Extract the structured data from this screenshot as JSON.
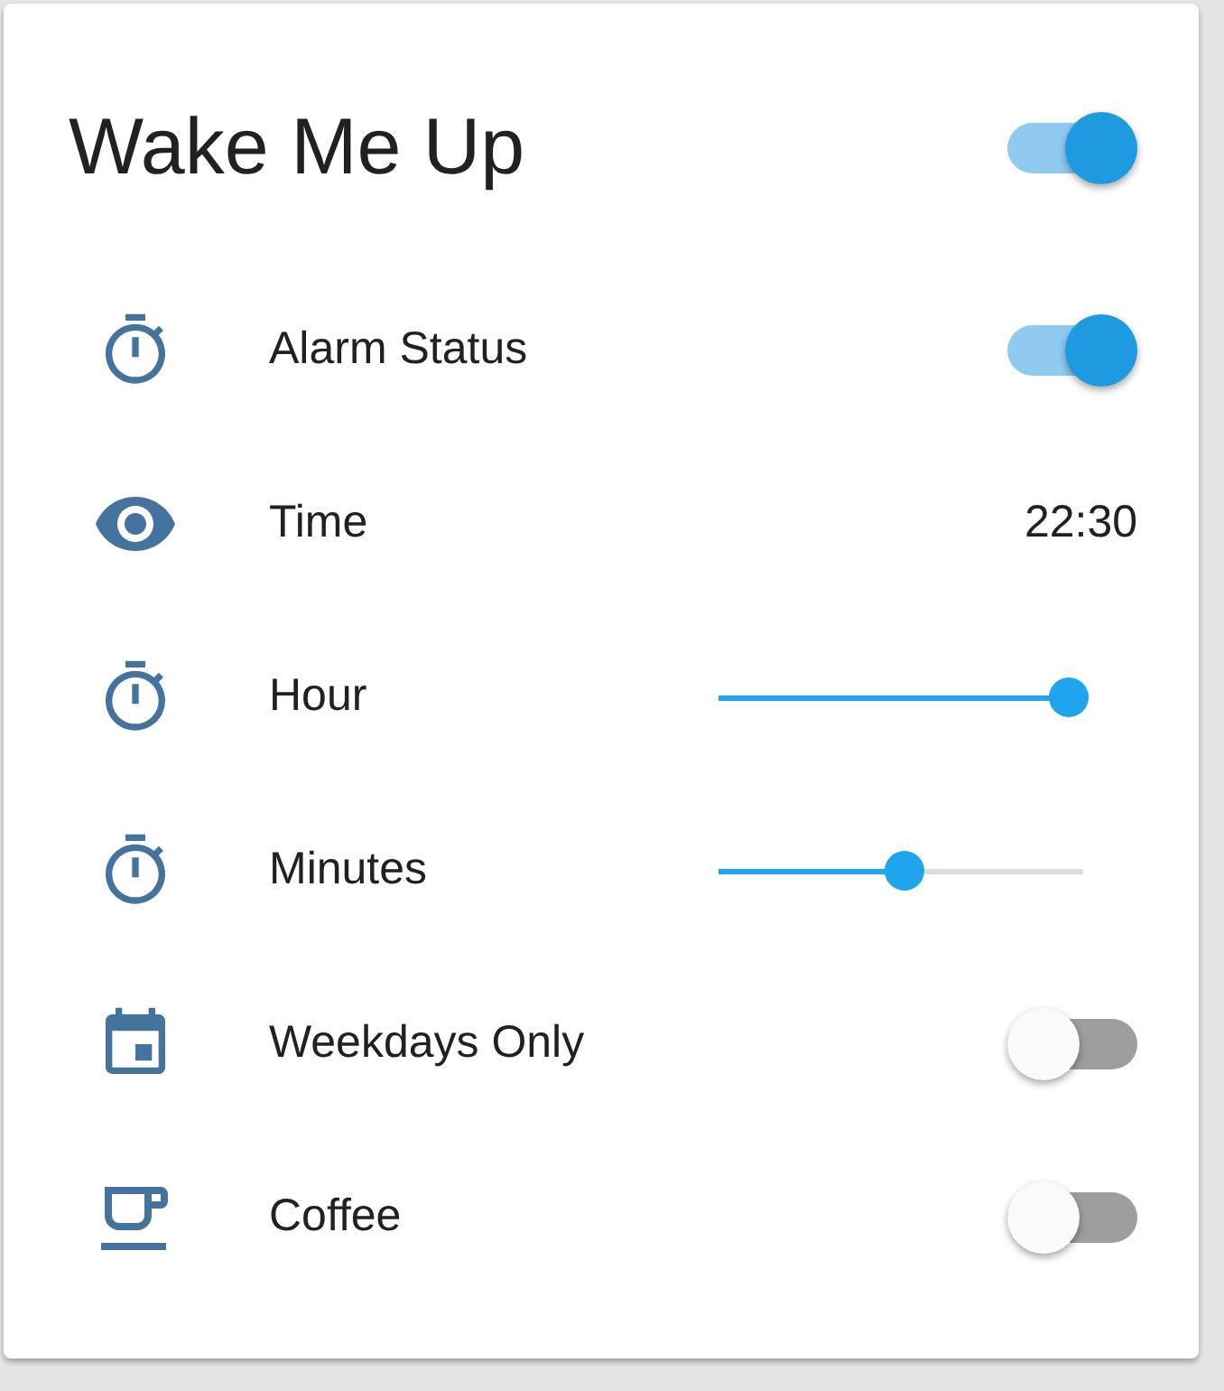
{
  "card": {
    "title": "Wake Me Up",
    "on": true
  },
  "rows": [
    {
      "kind": "toggle",
      "label": "Alarm Status",
      "on": true
    },
    {
      "kind": "text",
      "label": "Time",
      "value": "22:30"
    },
    {
      "kind": "slider",
      "label": "Hour",
      "level": 0.96
    },
    {
      "kind": "slider",
      "label": "Minutes",
      "level": 0.51
    },
    {
      "kind": "toggle",
      "label": "Weekdays Only",
      "on": false
    },
    {
      "kind": "toggle",
      "label": "Coffee",
      "on": false
    }
  ]
}
